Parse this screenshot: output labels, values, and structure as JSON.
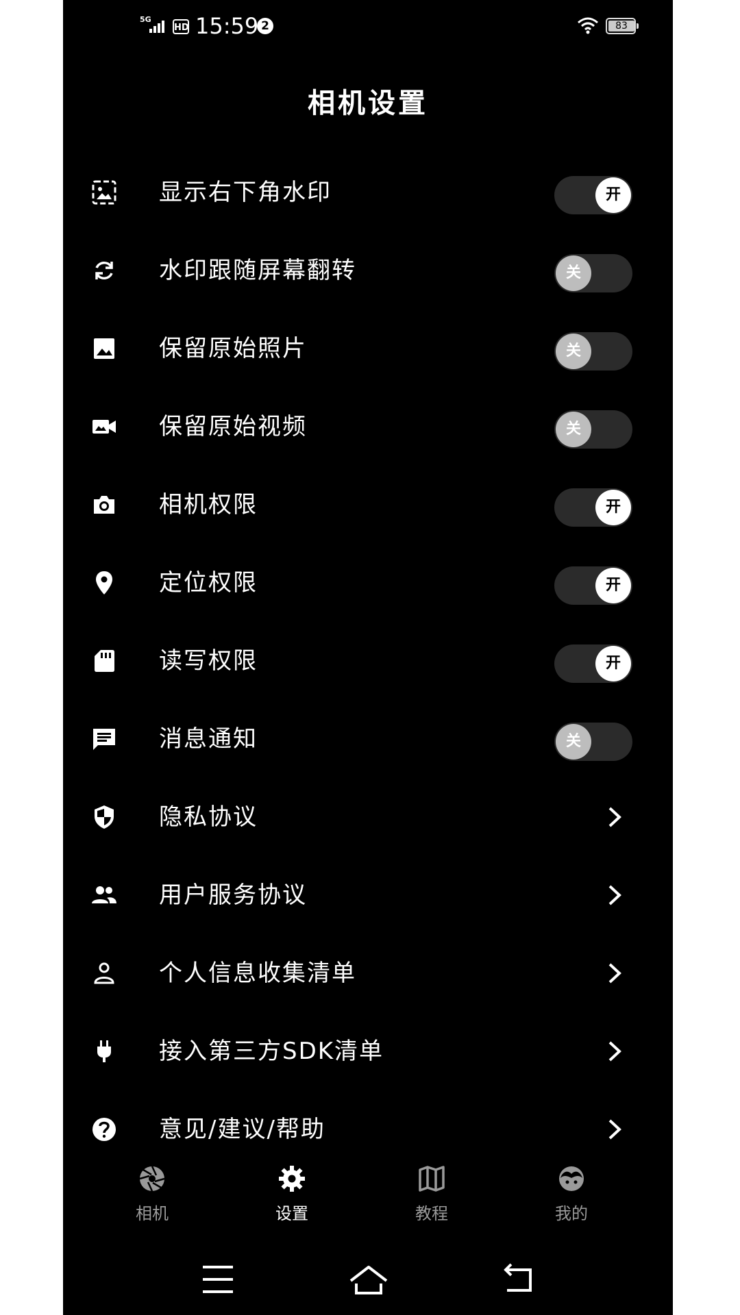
{
  "status_bar": {
    "network": "5G",
    "hd": "HD",
    "time": "15:59",
    "notification_count": "2",
    "battery": "83"
  },
  "page_title": "相机设置",
  "toggle_on_text": "开",
  "toggle_off_text": "关",
  "settings": [
    {
      "label": "显示右下角水印",
      "icon": "watermark-image-icon",
      "state": "on"
    },
    {
      "label": "水印跟随屏幕翻转",
      "icon": "sync-icon",
      "state": "off"
    },
    {
      "label": "保留原始照片",
      "icon": "image-icon",
      "state": "off"
    },
    {
      "label": "保留原始视频",
      "icon": "video-camera-icon",
      "state": "off"
    },
    {
      "label": "相机权限",
      "icon": "camera-icon",
      "state": "on"
    },
    {
      "label": "定位权限",
      "icon": "location-pin-icon",
      "state": "on"
    },
    {
      "label": "读写权限",
      "icon": "sd-card-icon",
      "state": "on"
    },
    {
      "label": "消息通知",
      "icon": "message-icon",
      "state": "off"
    }
  ],
  "links": [
    {
      "label": "隐私协议",
      "icon": "shield-icon"
    },
    {
      "label": "用户服务协议",
      "icon": "people-icon"
    },
    {
      "label": "个人信息收集清单",
      "icon": "person-icon"
    },
    {
      "label": "接入第三方SDK清单",
      "icon": "plug-icon"
    },
    {
      "label": "意见/建议/帮助",
      "icon": "help-icon"
    }
  ],
  "bottom_nav": [
    {
      "label": "相机",
      "icon": "aperture-icon",
      "active": false
    },
    {
      "label": "设置",
      "icon": "gear-icon",
      "active": true
    },
    {
      "label": "教程",
      "icon": "map-icon",
      "active": false
    },
    {
      "label": "我的",
      "icon": "face-icon",
      "active": false
    }
  ]
}
